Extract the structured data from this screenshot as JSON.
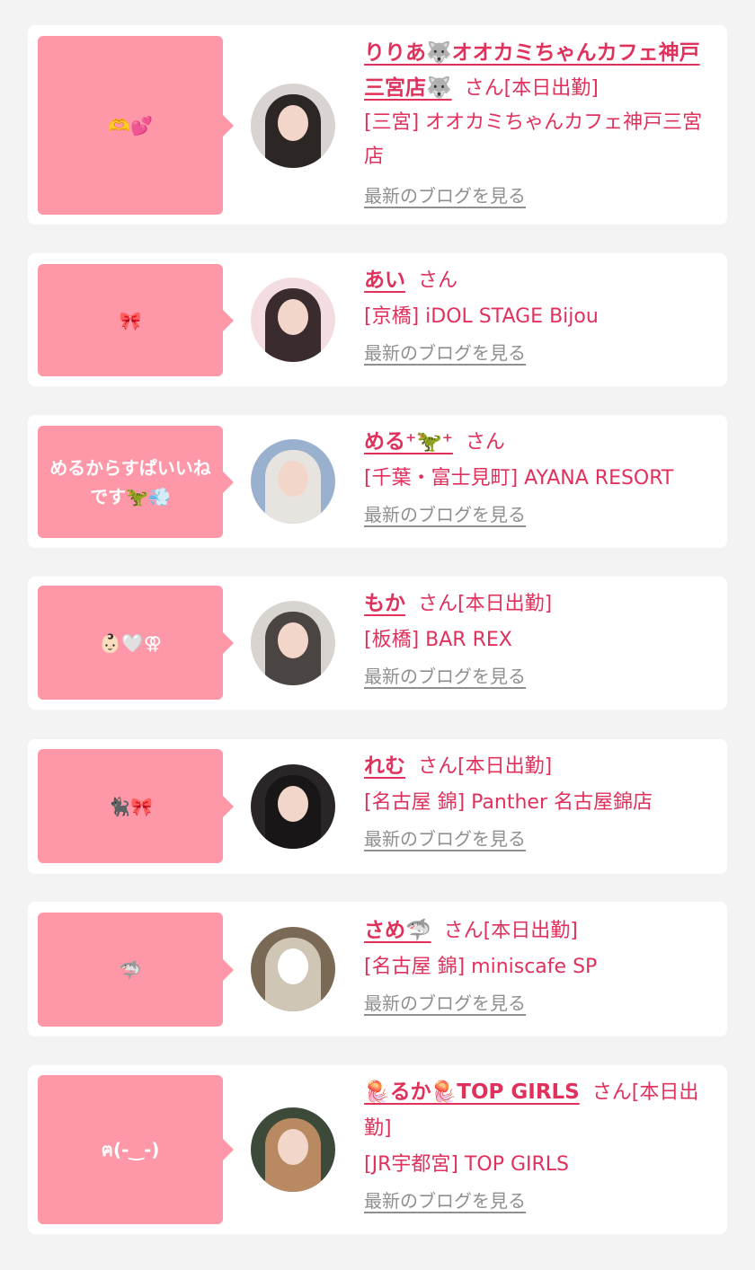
{
  "entries": [
    {
      "message": "🫶💕",
      "name": "りりあ🐺オオカミちゃんカフェ神戸三宮店🐺",
      "suffix": "さん[本日出勤]",
      "shop": "[三宮] オオカミちゃんカフェ神戸三宮店",
      "blog_link": "最新のブログを見る"
    },
    {
      "message": "🎀",
      "name": "あい",
      "suffix": "さん",
      "shop": "[京橋] iDOL STAGE Bijou",
      "blog_link": "最新のブログを見る"
    },
    {
      "message": "めるからすぱいいねです🦖💨",
      "name": "める⁺🦖⁺",
      "suffix": "さん",
      "shop": "[千葉・富士見町] AYANA RESORT",
      "blog_link": "最新のブログを見る"
    },
    {
      "message": "👶🏻🤍⚢",
      "name": "もか",
      "suffix": "さん[本日出勤]",
      "shop": "[板橋] BAR REX",
      "blog_link": "最新のブログを見る"
    },
    {
      "message": "🐈‍⬛🎀",
      "name": "れむ",
      "suffix": "さん[本日出勤]",
      "shop": "[名古屋 錦] Panther 名古屋錦店",
      "blog_link": "最新のブログを見る"
    },
    {
      "message": "🦈",
      "name": "さめ🦈",
      "suffix": "さん[本日出勤]",
      "shop": "[名古屋 錦] miniscafe SP",
      "blog_link": "最新のブログを見る"
    },
    {
      "message": "ฅ(-‿-)",
      "name": "🪼るか🪼TOP GIRLS",
      "suffix": "さん[本日出勤]",
      "shop": "[JR宇都宮] TOP GIRLS",
      "blog_link": "最新のブログを見る"
    }
  ]
}
